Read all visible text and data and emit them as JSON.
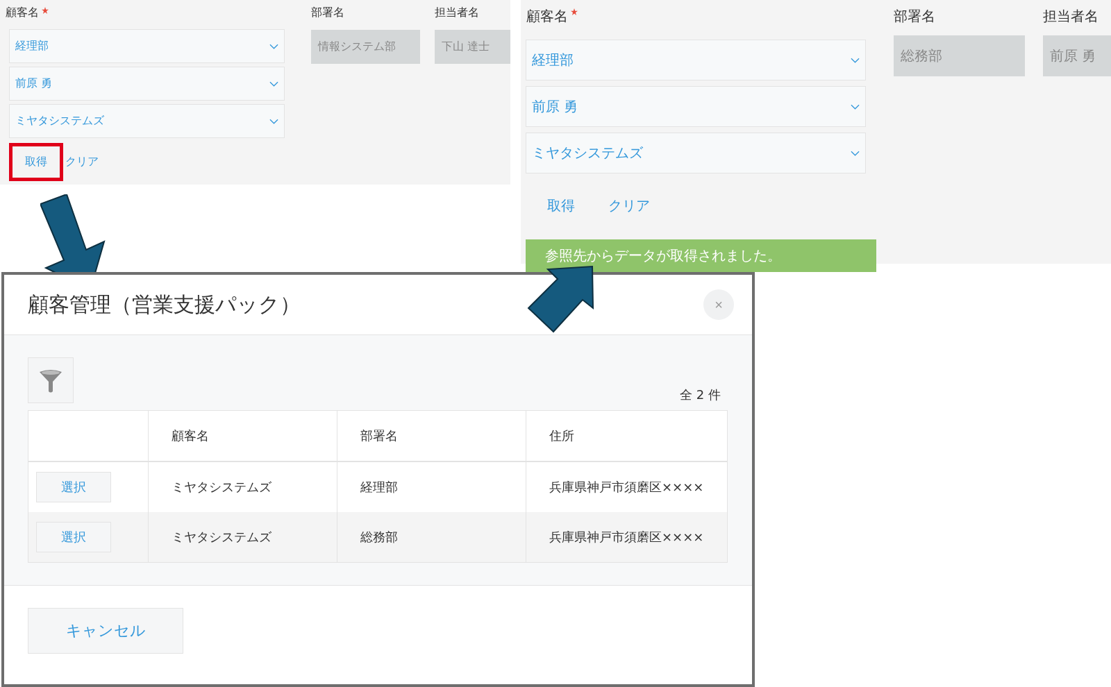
{
  "panels": [
    {
      "labels": [
        {
          "text": "顧客名",
          "required": true
        },
        {
          "text": "部署名",
          "required": false
        },
        {
          "text": "担当者名",
          "required": false
        }
      ],
      "selects": [
        "経理部",
        "前原 勇",
        "ミヤタシステムズ"
      ],
      "readonly_fields": [
        "情報システム部",
        "下山 達士"
      ],
      "buttons": [
        {
          "label": "取得",
          "highlighted": true
        },
        {
          "label": "クリア",
          "highlighted": false
        }
      ]
    },
    {
      "labels": [
        {
          "text": "顧客名",
          "required": true
        },
        {
          "text": "部署名",
          "required": false
        },
        {
          "text": "担当者名",
          "required": false
        }
      ],
      "selects": [
        "経理部",
        "前原 勇",
        "ミヤタシステムズ"
      ],
      "readonly_fields": [
        "総務部",
        "前原 勇"
      ],
      "buttons": [
        {
          "label": "取得",
          "highlighted": false
        },
        {
          "label": "クリア",
          "highlighted": false
        }
      ],
      "message": "参照先からデータが取得されました。"
    }
  ],
  "dialog": {
    "title": "顧客管理（営業支援パック）",
    "close": "×",
    "count": "全 2 件",
    "table": {
      "columns": [
        "顧客名",
        "部署名",
        "住所"
      ],
      "rows": [
        {
          "action": "選択",
          "cells": [
            "ミヤタシステムズ",
            "経理部",
            "兵庫県神戸市須磨区××××"
          ]
        },
        {
          "action": "選択",
          "cells": [
            "ミヤタシステムズ",
            "総務部",
            "兵庫県神戸市須磨区××××"
          ]
        }
      ]
    },
    "cancel": "キャンセル"
  }
}
